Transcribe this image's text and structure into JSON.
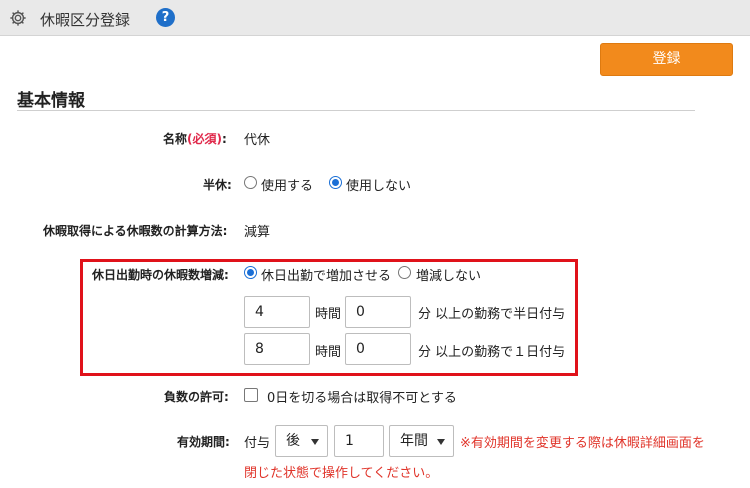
{
  "header": {
    "title": "休暇区分登録",
    "help_symbol": "?",
    "save_label": "登録"
  },
  "section": {
    "title": "基本情報"
  },
  "name_row": {
    "label": "名称",
    "required": "(必須)",
    "colon": ":",
    "value": "代休"
  },
  "half_row": {
    "label": "半休:",
    "option_use": "使用する",
    "option_nouse": "使用しない",
    "selected": "使用しない"
  },
  "calc_row": {
    "label": "休暇取得による休暇数の計算方法:",
    "value": "減算"
  },
  "holiday_row": {
    "label": "休日出勤時の休暇数増減:",
    "option_increase": "休日出勤で増加させる",
    "option_none": "増減しない",
    "selected": "休日出勤で増加させる",
    "half_hours": "4",
    "half_minutes": "0",
    "half_text": "分 以上の勤務で半日付与",
    "full_hours": "8",
    "full_minutes": "0",
    "full_text": "分 以上の勤務で１日付与",
    "hours_unit": "時間"
  },
  "negative_row": {
    "label": "負数の許可:",
    "checkbox_text": "0日を切る場合は取得不可とする",
    "checked": false
  },
  "validity_row": {
    "label": "有効期間:",
    "prefix": "付与",
    "direction": "後",
    "amount": "1",
    "unit": "年間",
    "note_line1": "※有効期間を変更する際は休暇詳細画面を",
    "note_line2": "閉じた状態で操作してください。"
  }
}
